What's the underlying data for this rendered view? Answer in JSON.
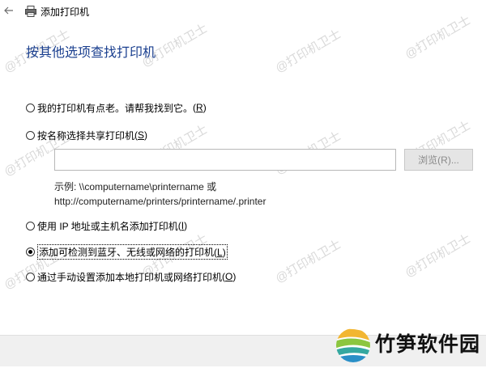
{
  "window": {
    "title": "添加打印机",
    "back_icon": "back-arrow-icon",
    "printer_icon": "printer-icon"
  },
  "heading": "按其他选项查找打印机",
  "options": [
    {
      "label": "我的打印机有点老。请帮我找到它。",
      "hotkey": "R",
      "checked": false
    },
    {
      "label": "按名称选择共享打印机",
      "hotkey": "S",
      "checked": false
    },
    {
      "label": "使用 IP 地址或主机名添加打印机",
      "hotkey": "I",
      "checked": false
    },
    {
      "label": "添加可检测到蓝牙、无线或网络的打印机",
      "hotkey": "L",
      "checked": true
    },
    {
      "label": "通过手动设置添加本地打印机或网络打印机",
      "hotkey": "O",
      "checked": false
    }
  ],
  "shared": {
    "input_value": "",
    "browse_label": "浏览(R)...",
    "example_line1": "示例: \\\\computername\\printername 或",
    "example_line2": "http://computername/printers/printername/.printer"
  },
  "watermark": "@打印机卫士",
  "brand": {
    "name": "竹笋软件园",
    "logo_icon": "bamboo-logo-icon"
  }
}
